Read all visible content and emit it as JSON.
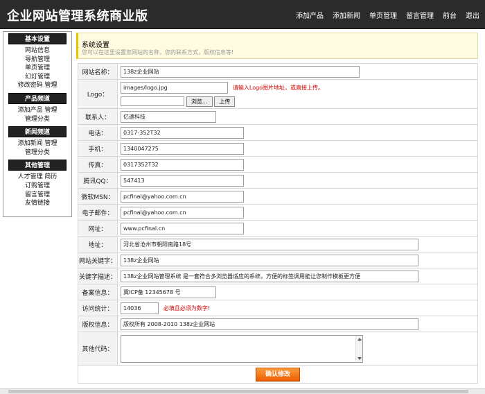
{
  "header": {
    "title": "企业网站管理系统商业版",
    "nav": [
      "添加产品",
      "添加新闻",
      "单页管理",
      "留言管理",
      "前台",
      "退出"
    ]
  },
  "sidebar": {
    "sections": [
      {
        "title": "基本设置",
        "items": [
          "网站信息",
          "导航管理",
          "单页管理",
          "幻灯管理",
          "修改密码 管理"
        ]
      },
      {
        "title": "产品频道",
        "items": [
          "添加产品 管理",
          "管理分类"
        ]
      },
      {
        "title": "新闻频道",
        "items": [
          "添加新闻 管理",
          "管理分类"
        ]
      },
      {
        "title": "其他管理",
        "items": [
          "人才管理 简历",
          "订购管理",
          "留言管理",
          "友情链接"
        ]
      }
    ]
  },
  "notice": {
    "title": "系统设置",
    "desc": "您可以在这里设置您网站的名称，您的联系方式，版权信息等!"
  },
  "form": {
    "site_name_label": "网站名称：",
    "site_name": "138z企业网站",
    "logo_label": "Logo：",
    "logo_path": "images/logo.jpg",
    "logo_hint": "请输入Logo图片地址，或直接上传。",
    "browse_label": "浏览...",
    "upload_label": "上传",
    "contact_label": "联系人：",
    "contact": "亿速科技",
    "phone_label": "电话：",
    "phone": "0317-352T32",
    "mobile_label": "手机：",
    "mobile": "1340047275",
    "fax_label": "传真：",
    "fax": "0317352T32",
    "qq_label": "腾讯QQ：",
    "qq": "547413",
    "msn_label": "微软MSN：",
    "msn": "pcfinal@yahoo.com.cn",
    "email_label": "电子邮件：",
    "email": "pcfinal@yahoo.com.cn",
    "url_label": "网址：",
    "url": "www.pcfinal.cn",
    "address_label": "地址：",
    "address": "河北省沧州市朝阳南路18号",
    "keywords_label": "网站关键字：",
    "keywords": "138z企业网站",
    "description_label": "关键字描述：",
    "description": "138z企业网站管理系统 是一套符合多浏览器适应的系统，方便的标签调用能让您制作模板更方便",
    "icp_label": "备案信息：",
    "icp": "冀ICP备 12345678 号",
    "stats_label": "访问统计：",
    "stats": "14036",
    "stats_hint": "必填且必须为数字!",
    "copyright_label": "版权信息：",
    "copyright": "版权所有 2008-2010 138z企业网站",
    "other_code_label": "其他代码：",
    "other_code": "",
    "submit_label": "确认修改"
  }
}
